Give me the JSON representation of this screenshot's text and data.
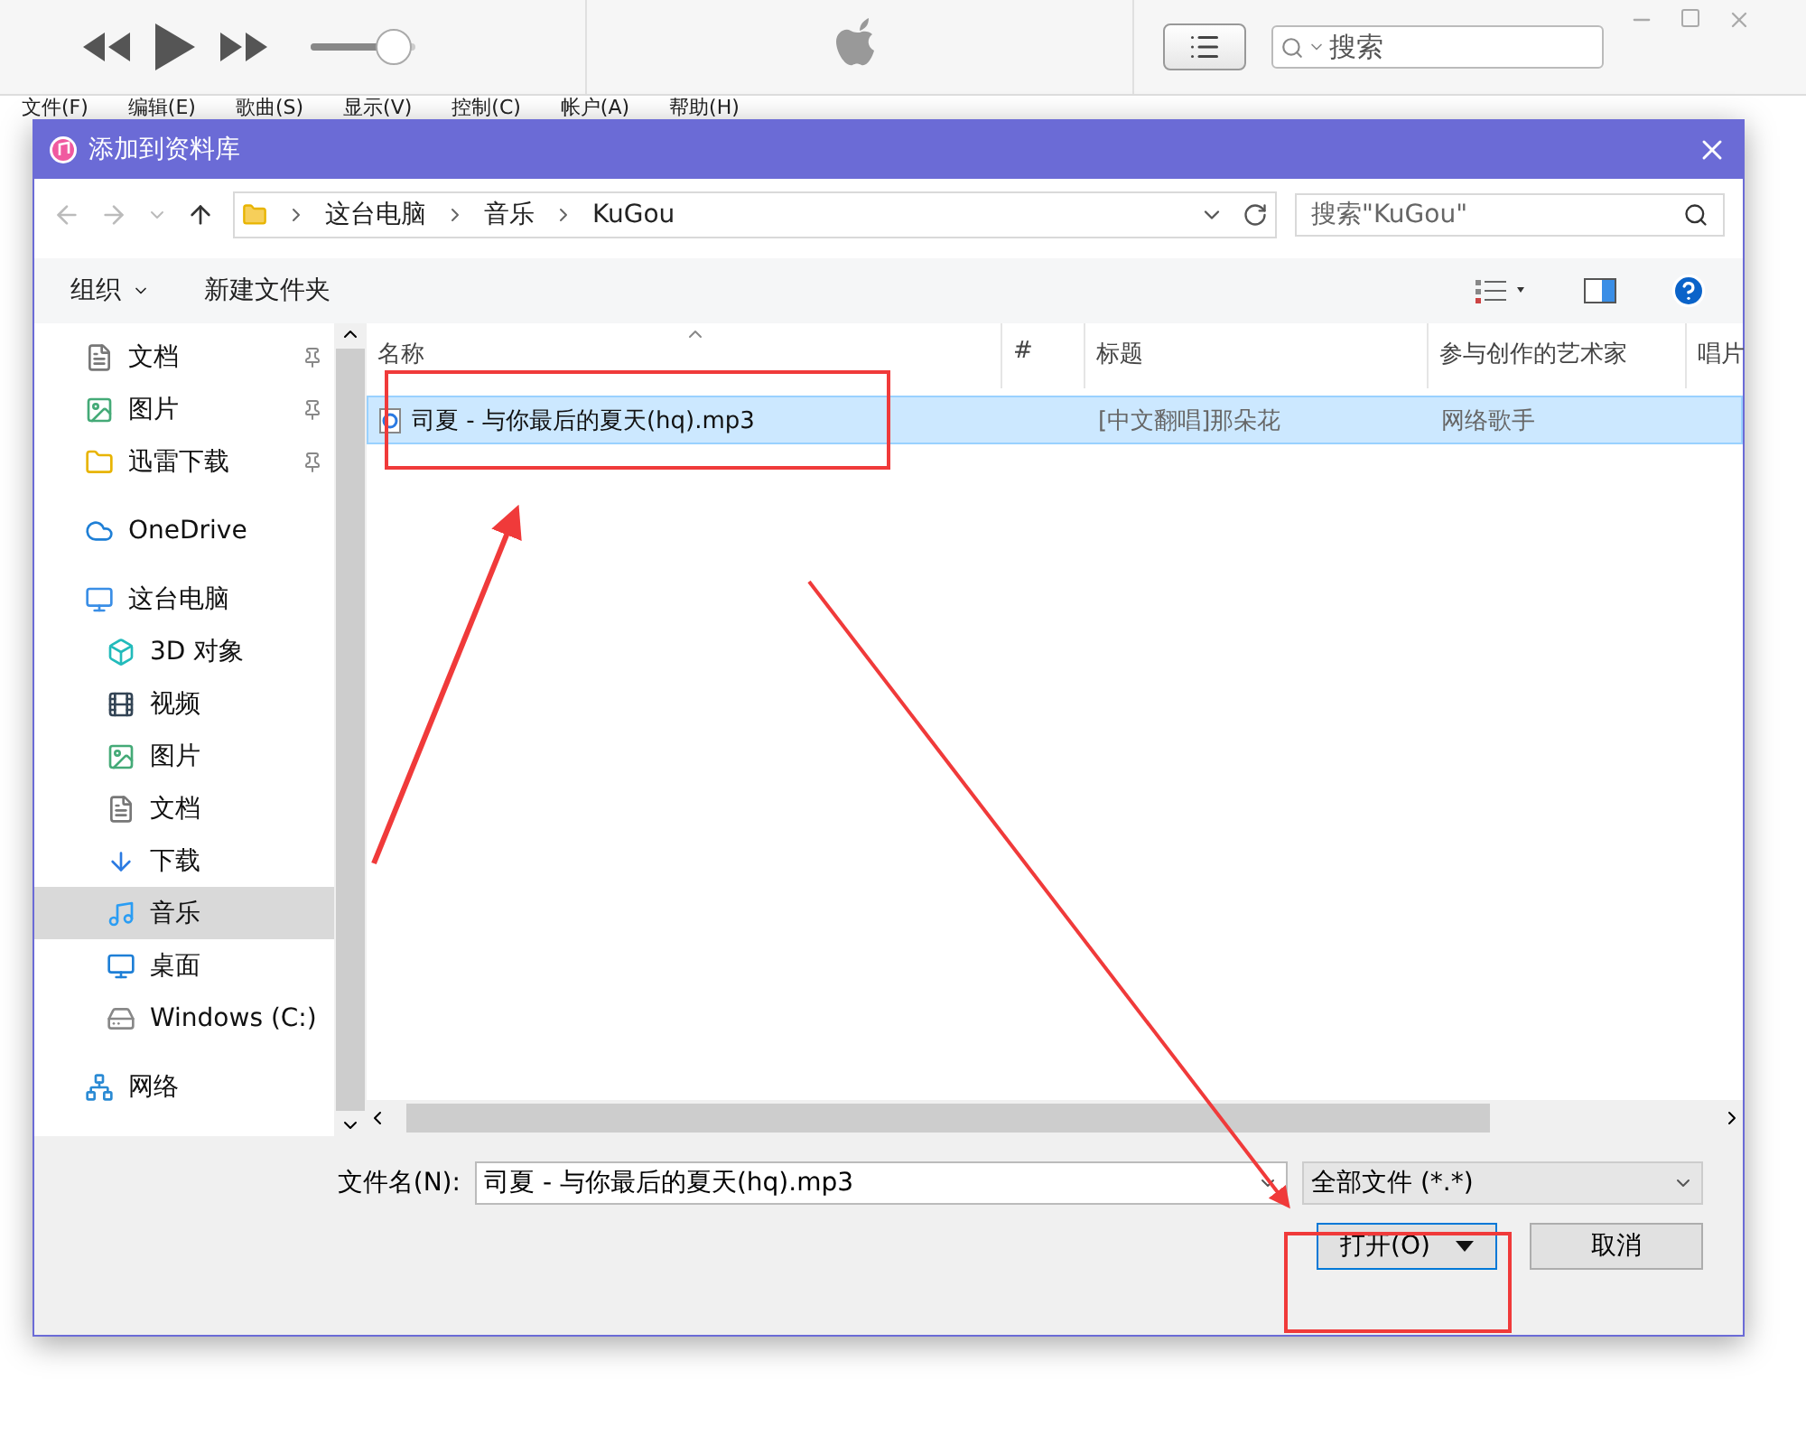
{
  "player": {
    "search": {
      "placeholder": "搜索"
    },
    "volume": {
      "level": 0.8
    }
  },
  "menu_bar": [
    "文件(F)",
    "编辑(E)",
    "歌曲(S)",
    "显示(V)",
    "控制(C)",
    "帐户(A)",
    "帮助(H)"
  ],
  "dialog": {
    "title": "添加到资料库",
    "breadcrumb": [
      "这台电脑",
      "音乐",
      "KuGou"
    ],
    "search": {
      "placeholder": "搜索\"KuGou\""
    },
    "toolbar": [
      {
        "label": "组织",
        "kind": "menu"
      },
      {
        "label": "新建文件夹",
        "kind": "button"
      }
    ],
    "nav": [
      {
        "label": "文档",
        "kind": "document",
        "pinned": true,
        "selected": false
      },
      {
        "label": "图片",
        "kind": "image",
        "pinned": true,
        "selected": false
      },
      {
        "label": "迅雷下载",
        "kind": "folder",
        "pinned": true,
        "selected": false
      },
      {
        "label": "OneDrive",
        "kind": "cloud",
        "pinned": false,
        "selected": false
      },
      {
        "label": "这台电脑",
        "kind": "computer",
        "pinned": false,
        "selected": false,
        "children": [
          {
            "label": "3D 对象",
            "kind": "cube",
            "pinned": false,
            "selected": false
          },
          {
            "label": "视频",
            "kind": "film",
            "pinned": false,
            "selected": false
          },
          {
            "label": "图片",
            "kind": "image",
            "pinned": false,
            "selected": false
          },
          {
            "label": "文档",
            "kind": "document",
            "pinned": false,
            "selected": false
          },
          {
            "label": "下载",
            "kind": "download",
            "pinned": false,
            "selected": false
          },
          {
            "label": "音乐",
            "kind": "music",
            "pinned": false,
            "selected": true
          },
          {
            "label": "桌面",
            "kind": "desktop",
            "pinned": false,
            "selected": false
          },
          {
            "label": "Windows (C:)",
            "kind": "drive",
            "pinned": false,
            "selected": false
          }
        ]
      },
      {
        "label": "网络",
        "kind": "network",
        "pinned": false,
        "selected": false
      }
    ],
    "columns": [
      "名称",
      "#",
      "标题",
      "参与创作的艺术家",
      "唱片"
    ],
    "rows": [
      {
        "name": "司夏 - 与你最后的夏天(hq).mp3",
        "title": "[中文翻唱]那朵花",
        "artist": "网络歌手",
        "selected": true
      }
    ],
    "file_name": {
      "label": "文件名(N):",
      "value": "司夏 - 与你最后的夏天(hq).mp3"
    },
    "file_type": "全部文件 (*.*)",
    "buttons": [
      {
        "label": "打开(O)",
        "kind": "split"
      },
      {
        "label": "取消",
        "kind": "plain"
      }
    ]
  }
}
